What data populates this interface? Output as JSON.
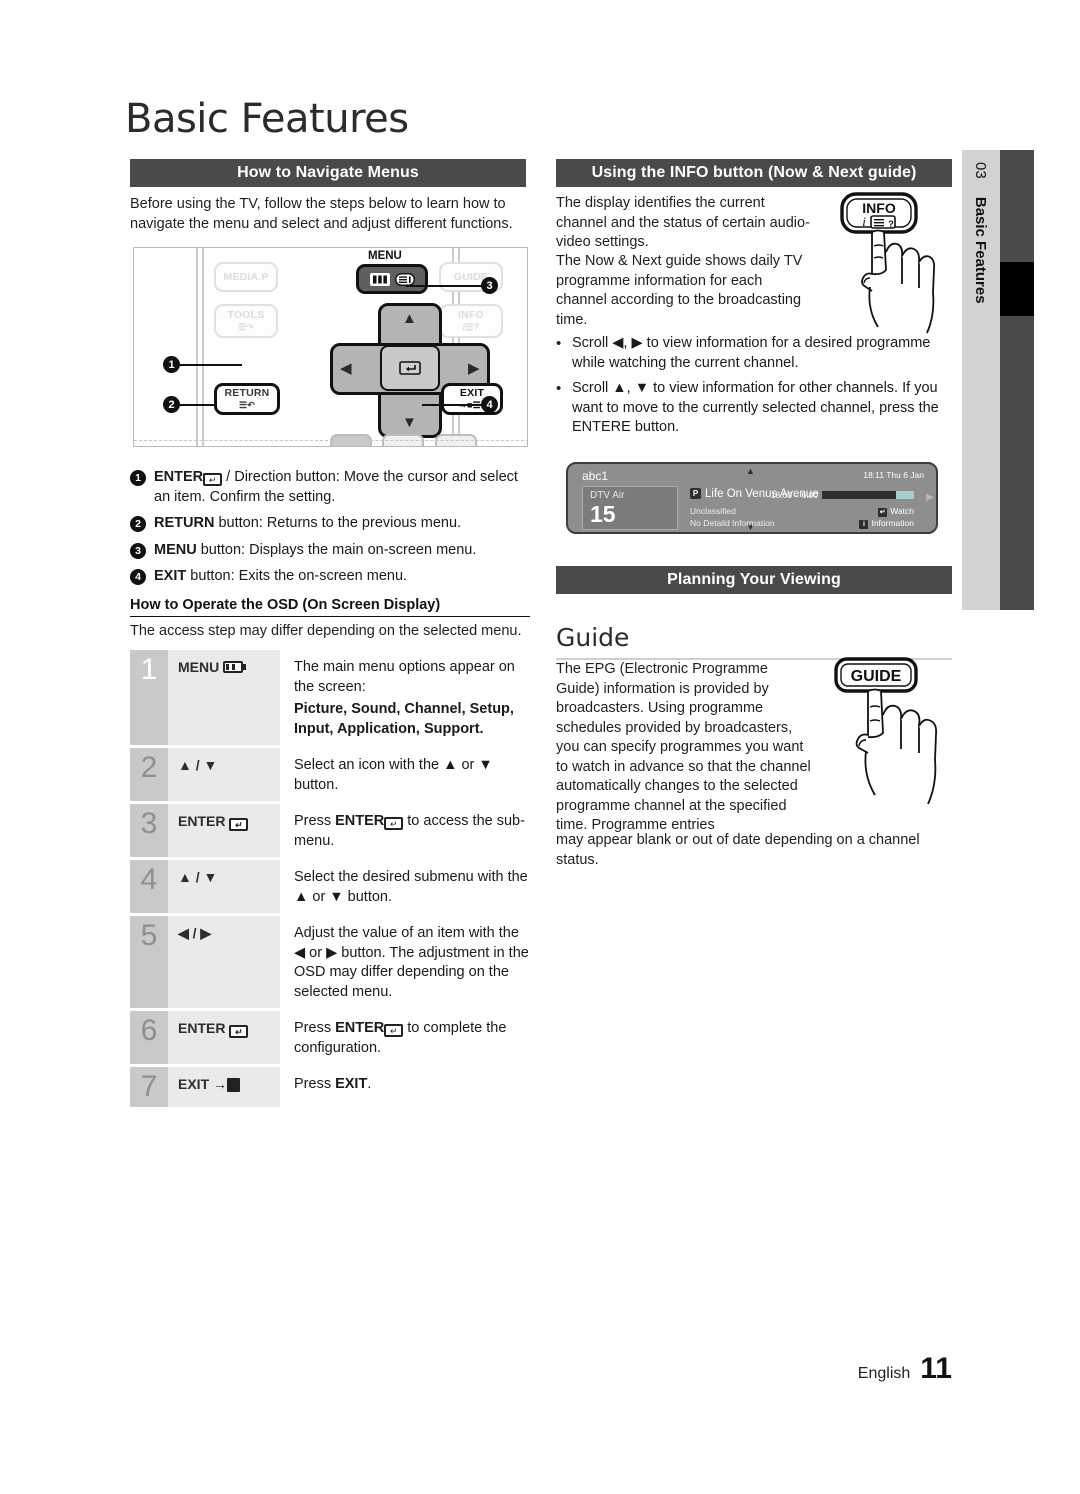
{
  "page_title": "Basic Features",
  "chapter_tab": {
    "number": "03",
    "name": "Basic Features"
  },
  "footer": {
    "language": "English",
    "page_number": "11"
  },
  "left_column": {
    "section_header": "How to Navigate Menus",
    "intro": "Before using the TV, follow the steps below to learn how to navigate the menu and select and adjust different functions.",
    "remote_diagram": {
      "buttons": [
        "MEDIA.P",
        "MENU",
        "GUIDE",
        "TOOLS",
        "INFO",
        "RETURN",
        "EXIT"
      ],
      "menu_caption": "MENU",
      "callouts": [
        "1",
        "2",
        "3",
        "4"
      ]
    },
    "callout_list": [
      {
        "num": "1",
        "text": "ENTERE / Direction button: Move the cursor and select an item. Confirm the setting.",
        "lead": "ENTER",
        "rest": " / Direction button: Move the cursor and select an item. Confirm the setting."
      },
      {
        "num": "2",
        "lead": "RETURN",
        "rest": " button: Returns to the previous menu."
      },
      {
        "num": "3",
        "lead": "MENU",
        "rest": " button: Displays the main on-screen menu."
      },
      {
        "num": "4",
        "lead": "EXIT",
        "rest": " button: Exits the on-screen menu."
      }
    ],
    "osd_heading": "How to Operate the OSD (On Screen Display)",
    "osd_note": "The access step may differ depending on the selected menu.",
    "steps": [
      {
        "n": "1",
        "key": "MENU",
        "desc_line1": "The main menu options appear on the screen:",
        "desc_bold": "Picture, Sound, Channel, Setup, Input, Application, Support."
      },
      {
        "n": "2",
        "key": "▲ / ▼",
        "desc": "Select an icon with the ▲ or ▼ button."
      },
      {
        "n": "3",
        "key": "ENTER",
        "desc_pre": "Press ",
        "desc_bold": "ENTER",
        "desc_post": " to access the sub-menu."
      },
      {
        "n": "4",
        "key": "▲ / ▼",
        "desc": "Select the desired submenu with the ▲ or ▼ button."
      },
      {
        "n": "5",
        "key": "◀ / ▶",
        "desc": "Adjust the value of an item with the ◀ or ▶ button. The adjustment in the OSD may differ depending on the selected menu."
      },
      {
        "n": "6",
        "key": "ENTER",
        "desc_pre": "Press ",
        "desc_bold": "ENTER",
        "desc_post": " to complete the configuration."
      },
      {
        "n": "7",
        "key": "EXIT",
        "desc_pre": "Press ",
        "desc_bold": "EXIT",
        "desc_post": "."
      }
    ]
  },
  "right_column": {
    "info_section_header": "Using the INFO button (Now & Next guide)",
    "info_p1": "The display identifies the current channel and the status of certain audio-video settings.",
    "info_p2": "The Now & Next guide shows daily TV programme information for each channel according to the broadcasting time.",
    "info_bullets": [
      "Scroll ◀, ▶ to view information for a desired programme while watching the current channel.",
      "Scroll ▲, ▼ to view information for other channels. If you want to move to the currently selected channel, press the ENTERE button."
    ],
    "info_button_label": "INFO",
    "osd_banner": {
      "channel_name": "abc1",
      "clock": "18:11 Thu 6 Jan",
      "source": "DTV Air",
      "channel_number": "15",
      "programme_title": "Life On Venus Avenue",
      "rating_badge": "P",
      "classification": "Unclassified",
      "detail": "No Detaild Information",
      "time_range": "18:00 – 6:00",
      "action_watch": "Watch",
      "action_information": "Information"
    },
    "planning_section_header": "Planning Your Viewing",
    "guide_heading": "Guide",
    "guide_p1": "The EPG (Electronic Programme Guide) information is provided by broadcasters. Using programme schedules provided by broadcasters, you can specify programmes you want to watch in advance so that the channel automatically changes to the selected programme channel at the specified time. Programme entries",
    "guide_p2": "may appear blank or out of date depending on a channel status.",
    "guide_button_label": "GUIDE"
  }
}
